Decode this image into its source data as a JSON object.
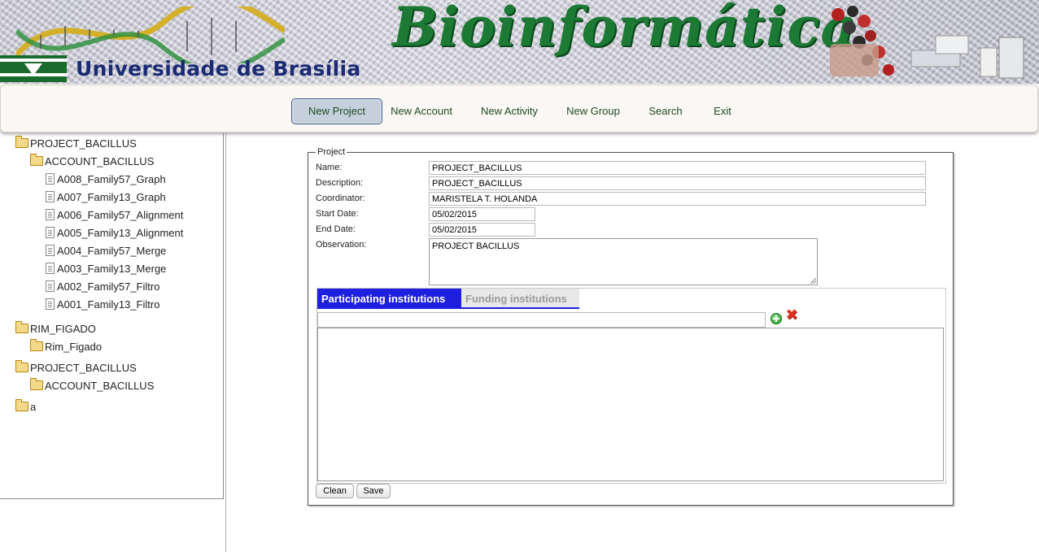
{
  "banner": {
    "university": "Universidade de Brasília",
    "title": "Bioinformática"
  },
  "nav": {
    "items": [
      "New Project",
      "New Account",
      "New Activity",
      "New Group",
      "Search",
      "Exit"
    ],
    "active": "New Project"
  },
  "tree": [
    {
      "label": "PROJECT_BACILLUS",
      "type": "folder"
    },
    {
      "label": "ACCOUNT_BACILLUS",
      "type": "folder"
    },
    {
      "label": "A008_Family57_Graph",
      "type": "file"
    },
    {
      "label": "A007_Family13_Graph",
      "type": "file"
    },
    {
      "label": "A006_Family57_Alignment",
      "type": "file"
    },
    {
      "label": "A005_Family13_Alignment",
      "type": "file"
    },
    {
      "label": "A004_Family57_Merge",
      "type": "file"
    },
    {
      "label": "A003_Family13_Merge",
      "type": "file"
    },
    {
      "label": "A002_Family57_Filtro",
      "type": "file"
    },
    {
      "label": "A001_Family13_Filtro",
      "type": "file"
    },
    {
      "label": "RIM_FIGADO",
      "type": "folder"
    },
    {
      "label": "Rim_Figado",
      "type": "folder"
    },
    {
      "label": "PROJECT_BACILLUS",
      "type": "folder"
    },
    {
      "label": "ACCOUNT_BACILLUS",
      "type": "folder"
    },
    {
      "label": "a",
      "type": "folder"
    }
  ],
  "form": {
    "legend": "Project",
    "name_label": "Name:",
    "name_value": "PROJECT_BACILLUS",
    "description_label": "Description:",
    "description_value": "PROJECT_BACILLUS",
    "coordinator_label": "Coordinator:",
    "coordinator_value": "MARISTELA T. HOLANDA",
    "start_label": "Start Date:",
    "start_value": "05/02/2015",
    "end_label": "End Date:",
    "end_value": "05/02/2015",
    "observation_label": "Observation:",
    "observation_value": "PROJECT BACILLUS",
    "tabs": [
      "Participating institutions",
      "Funding institutions"
    ],
    "active_tab": "Participating institutions",
    "clean_label": "Clean",
    "save_label": "Save"
  },
  "colors": {
    "title_green": "#1d7a35",
    "unb_blue": "#1a2a73",
    "nav_text": "#1e4b22",
    "active_tab": "#1f1fe0"
  }
}
